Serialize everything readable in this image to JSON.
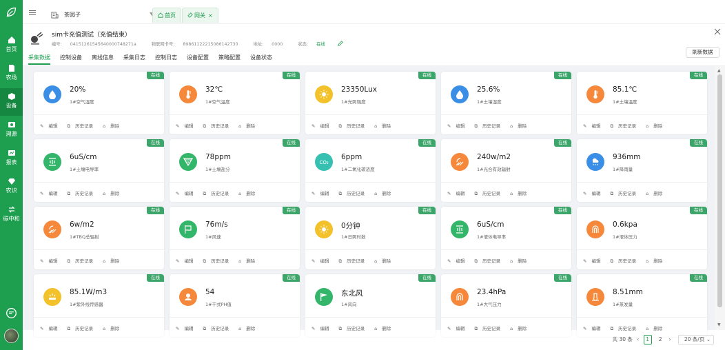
{
  "sidebar": {
    "items": [
      {
        "label": "首页",
        "icon": "home-icon"
      },
      {
        "label": "农场",
        "icon": "farm-icon"
      },
      {
        "label": "设备",
        "icon": "device-icon",
        "active": true
      },
      {
        "label": "溯源",
        "icon": "trace-icon"
      },
      {
        "label": "报表",
        "icon": "report-icon"
      },
      {
        "label": "农识",
        "icon": "knowledge-icon"
      },
      {
        "label": "碳中和",
        "icon": "carbon-icon"
      }
    ]
  },
  "topbar": {
    "farm": "茶园子",
    "tabs": [
      {
        "label": "首页",
        "icon": "home-icon"
      },
      {
        "label": "网关",
        "icon": "gateway-icon",
        "closable": true
      }
    ]
  },
  "device": {
    "title": "sim卡充值测试（充值结束）",
    "code_label": "编号:",
    "code": "041512615456400007482​71a",
    "card_label": "物联网卡号:",
    "card": "89861122215086142730",
    "addr_label": "地址:",
    "addr": "0000",
    "status_label": "状态:",
    "status": "在线"
  },
  "tabs": [
    "采集数据",
    "控制设备",
    "离线信息",
    "采集日志",
    "控制日志",
    "设备配置",
    "策略配置",
    "设备状态"
  ],
  "refresh_label": "刷新数据",
  "card_actions": {
    "edit": "编辑",
    "history": "历史记录",
    "delete": "删除"
  },
  "sensors": [
    {
      "value": "20%",
      "name": "1#空气湿度",
      "status": "在线",
      "color": "#3a8ee6",
      "icon": "drop-icon"
    },
    {
      "value": "32℃",
      "name": "1#空气温度",
      "status": "在线",
      "color": "#f5883a",
      "icon": "thermometer-icon"
    },
    {
      "value": "23350Lux",
      "name": "1#光照强度",
      "status": "在线",
      "color": "#f3c129",
      "icon": "sun-icon"
    },
    {
      "value": "25.6%",
      "name": "1#土壤湿度",
      "status": "在线",
      "color": "#3a8ee6",
      "icon": "drop-icon"
    },
    {
      "value": "85.1℃",
      "name": "1#土壤温度",
      "status": "在线",
      "color": "#f5883a",
      "icon": "thermometer-icon"
    },
    {
      "value": "6uS/cm",
      "name": "1#土壤电导率",
      "status": "在线",
      "color": "#33b56a",
      "icon": "conductivity-icon"
    },
    {
      "value": "78ppm",
      "name": "1#土壤盐分",
      "status": "在线",
      "color": "#33b56a",
      "icon": "salt-icon"
    },
    {
      "value": "6ppm",
      "name": "1#二氧化碳浓度",
      "status": "在线",
      "color": "#35c0b2",
      "icon": "co2-icon"
    },
    {
      "value": "240w/m2",
      "name": "1#光合有效辐射",
      "status": "在线",
      "color": "#f5883a",
      "icon": "radiation-icon"
    },
    {
      "value": "936mm",
      "name": "1#降雨量",
      "status": "在线",
      "color": "#3a8ee6",
      "icon": "rain-icon"
    },
    {
      "value": "6w/m2",
      "name": "1#TBQ总辐射",
      "status": "在线",
      "color": "#f5883a",
      "icon": "radiation-icon"
    },
    {
      "value": "76m/s",
      "name": "1#风速",
      "status": "在线",
      "color": "#33b56a",
      "icon": "wind-speed-icon"
    },
    {
      "value": "0分钟",
      "name": "1#日照时数",
      "status": "在线",
      "color": "#f3c129",
      "icon": "sun-icon"
    },
    {
      "value": "6uS/cm",
      "name": "1#液体电导率",
      "status": "在线",
      "color": "#33b56a",
      "icon": "conductivity-icon"
    },
    {
      "value": "0.6kpa",
      "name": "1#液体压力",
      "status": "在线",
      "color": "#f5883a",
      "icon": "pressure-icon"
    },
    {
      "value": "85.1W/m3",
      "name": "1#紫外线传感器",
      "status": "在线",
      "color": "#f3c129",
      "icon": "uv-icon"
    },
    {
      "value": "54",
      "name": "1#干式PH值",
      "status": "在线",
      "color": "#f5883a",
      "icon": "ph-icon"
    },
    {
      "value": "东北风",
      "name": "1#风向",
      "status": "在线",
      "color": "#33b56a",
      "icon": "wind-direction-icon"
    },
    {
      "value": "23.4hPa",
      "name": "1#大气压力",
      "status": "在线",
      "color": "#f5883a",
      "icon": "pressure-icon"
    },
    {
      "value": "8.51mm",
      "name": "1#蒸发量",
      "status": "在线",
      "color": "#f5883a",
      "icon": "evaporation-icon"
    }
  ],
  "pager": {
    "total": "共 30 条",
    "pages": [
      "1",
      "2"
    ],
    "current": "1",
    "size": "20 条/页"
  }
}
